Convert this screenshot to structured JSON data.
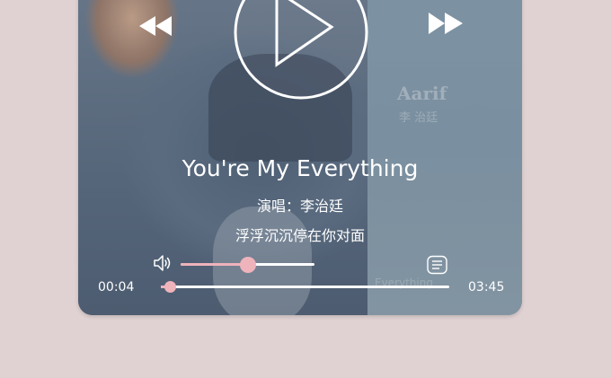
{
  "player": {
    "song_title": "You're My Everything",
    "artist_line": "演唱：李治廷",
    "lyric_line": "浮浮沉沉停在你对面",
    "current_time": "00:04",
    "total_time": "03:45",
    "progress_fraction": 0.03,
    "volume_fraction": 0.5,
    "accent_color": "#efb3bc",
    "background_color": "#e0d2d3"
  },
  "album_art": {
    "brand": "Aarif",
    "brand_sub": "李 治廷",
    "bottom_text": "Everything"
  },
  "icons": {
    "prev": "rewind-icon",
    "play": "play-icon",
    "next": "fast-forward-icon",
    "volume": "volume-icon",
    "playlist": "playlist-icon"
  }
}
